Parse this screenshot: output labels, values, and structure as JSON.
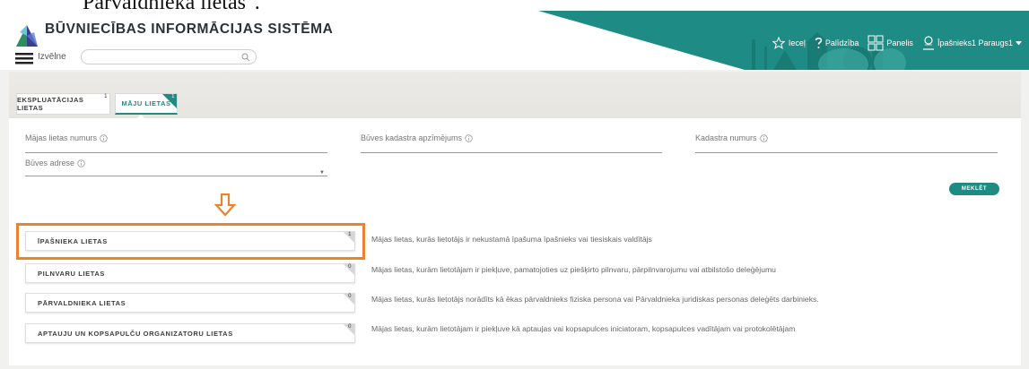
{
  "caption": "Pārvaldnieka lietas\".",
  "header": {
    "app_title": "BŪVNIECĪBAS INFORMĀCIJAS SISTĒMA",
    "menu_label": "Izvēlne",
    "search_placeholder": "",
    "nav": {
      "favorites": "Ieceļ",
      "help": "Palīdzība",
      "panel": "Panelis",
      "user": "Īpašnieks1 Paraugs1"
    },
    "brand_color": "#1e8b84"
  },
  "tabs": [
    {
      "label": "EKSPLUATĀCIJAS LIETAS",
      "badge": "1",
      "active": false
    },
    {
      "label": "MĀJU LIETAS",
      "badge": "1",
      "active": true
    }
  ],
  "filters": {
    "house_case_number": "Mājas lietas numurs",
    "building_cadastre": "Būves kadastra apzīmējums",
    "cadastre_number": "Kadastra numurs",
    "building_address": "Būves adrese",
    "search_button": "MEKLĒT"
  },
  "categories": [
    {
      "label": "ĪPAŠNIEKA LIETAS",
      "count": "1",
      "description": "Mājas lietas, kurās lietotājs ir nekustamā īpašuma īpašnieks vai tiesiskais valdītājs"
    },
    {
      "label": "PILNVARU LIETAS",
      "count": "0",
      "description": "Mājas lietas, kurām lietotājam ir piekļuve, pamatojoties uz piešķirto pilnvaru, pārpilnvarojumu vai atbilstošo deleģējumu"
    },
    {
      "label": "PĀRVALDNIEKA LIETAS",
      "count": "0",
      "description": "Mājas lietas, kurās lietotājs norādīts kā ēkas pārvaldnieks fiziska persona vai Pārvaldnieka juridiskas personas deleģēts darbinieks."
    },
    {
      "label": "APTAUJU UN KOPSAPULČU ORGANIZATORU LIETAS",
      "count": "0",
      "description": "Mājas lietas, kurām lietotājam ir piekļuve kā aptaujas vai kopsapulces iniciatoram, kopsapulces vadītājam vai protokolētājam"
    }
  ],
  "annotation_color": "#e8832f"
}
